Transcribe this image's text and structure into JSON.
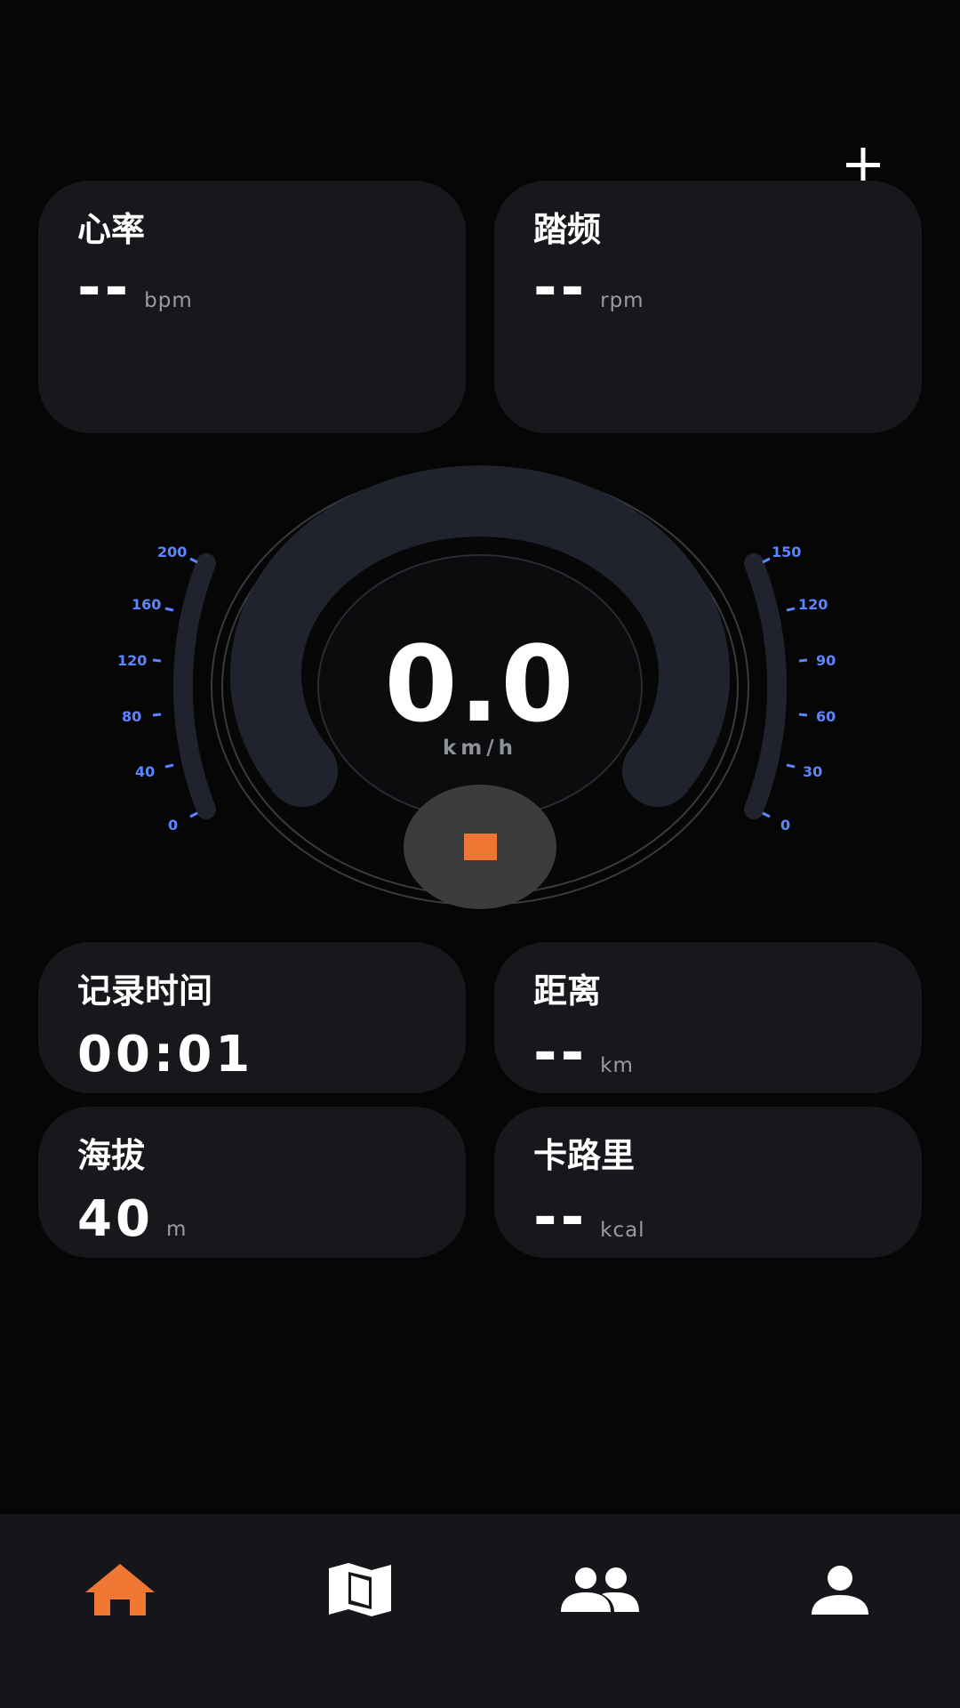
{
  "header": {
    "add_icon": "plus-icon"
  },
  "metrics": {
    "heart_rate": {
      "title": "心率",
      "value": "--",
      "unit": "bpm"
    },
    "cadence": {
      "title": "踏频",
      "value": "--",
      "unit": "rpm"
    },
    "record_time": {
      "title": "记录时间",
      "value": "00:01"
    },
    "distance": {
      "title": "距离",
      "value": "--",
      "unit": "km"
    },
    "altitude": {
      "title": "海拔",
      "value": "40",
      "unit": "m"
    },
    "calories": {
      "title": "卡路里",
      "value": "--",
      "unit": "kcal"
    }
  },
  "speedometer": {
    "value": "0.0",
    "unit": "km/h",
    "left_scale": [
      "0",
      "40",
      "80",
      "120",
      "160",
      "200"
    ],
    "right_scale": [
      "0",
      "30",
      "60",
      "90",
      "120",
      "150"
    ],
    "stop_icon": "stop-icon"
  },
  "colors": {
    "accent": "#ef7733",
    "scale": "#5a86ff",
    "card_bg": "#17181c",
    "background": "#060607"
  },
  "tabbar": {
    "items": [
      {
        "name": "home",
        "icon": "home-icon",
        "active": true
      },
      {
        "name": "map",
        "icon": "map-icon",
        "active": false
      },
      {
        "name": "group",
        "icon": "group-icon",
        "active": false
      },
      {
        "name": "profile",
        "icon": "person-icon",
        "active": false
      }
    ]
  }
}
